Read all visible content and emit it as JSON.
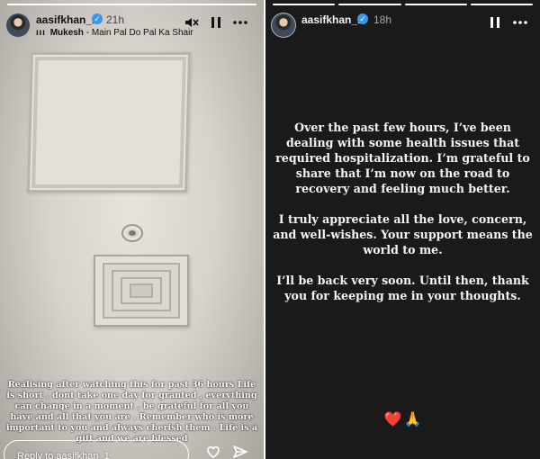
{
  "left_story": {
    "progress_segments": [
      1,
      0,
      0
    ],
    "username": "aasifkhan_1",
    "timestamp": "21h",
    "music": {
      "artist": "Mukesh",
      "separator": " - ",
      "song": "Main Pal Do Pal Ka Shair"
    },
    "icons": [
      "mute-icon",
      "pause-icon",
      "more-icon"
    ],
    "caption": "Realising after watching this for past 36 hours Life is short , dont take one day for granted , everything can change in a moment , be grateful for all you have and all that you are . Remember who is more important to you and always cherish them . Life is a gift and we are blessed",
    "reply_placeholder": "Reply to aasifkhan_1",
    "footer_icons": [
      "heart-icon",
      "send-icon"
    ]
  },
  "right_story": {
    "progress_segments": [
      1,
      1,
      1,
      1
    ],
    "username": "aasifkhan_1",
    "timestamp": "18h",
    "icons": [
      "pause-icon",
      "more-icon"
    ],
    "paragraphs": [
      "Over the past few hours, I’ve been dealing with some health issues that required hospitalization. I’m grateful to share that I’m now on the road to recovery and feeling much better.",
      "I truly appreciate all the love, concern, and well-wishes. Your support means the world to me.",
      "I’ll be back very soon. Until then, thank you for keeping me in your thoughts."
    ],
    "emojis": {
      "heart": "❤️",
      "folded_hands": "🙏"
    }
  },
  "colors": {
    "verified": "#3897f0",
    "right_bg": "#1a1a1a",
    "left_bg": "#d9d4cd"
  }
}
